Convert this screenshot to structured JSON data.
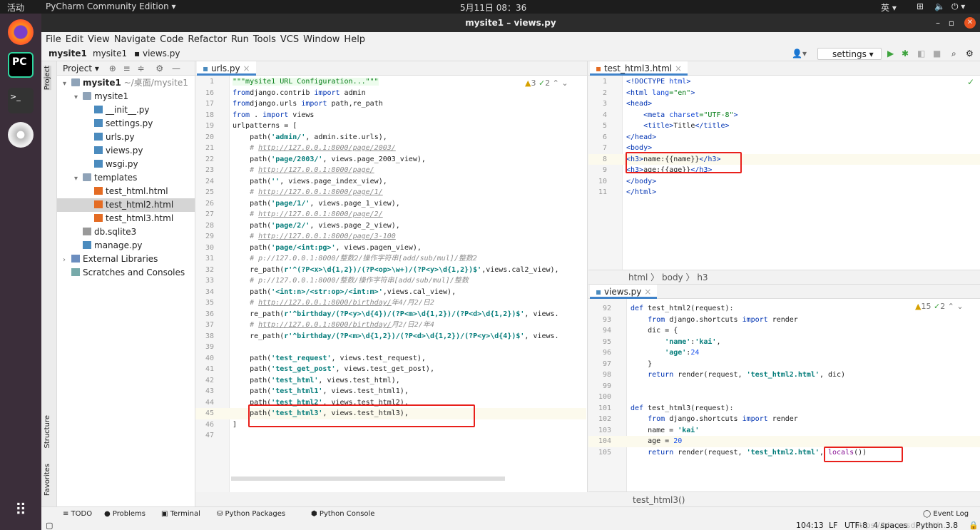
{
  "topbar": {
    "activities": "活动",
    "app": "PyCharm Community Edition ▾",
    "clock": "5月11日 08：36",
    "ime": "英 ▾"
  },
  "window": {
    "title": "mysite1 – views.py"
  },
  "menu": [
    "File",
    "Edit",
    "View",
    "Navigate",
    "Code",
    "Refactor",
    "Run",
    "Tools",
    "VCS",
    "Window",
    "Help"
  ],
  "breadcrumb": [
    "mysite1",
    "mysite1",
    "views.py"
  ],
  "run_config": "settings",
  "left_strip": [
    "Project",
    "Structure",
    "Favorites"
  ],
  "project": {
    "header": "Project ▾",
    "tree": [
      {
        "label": "mysite1",
        "extra": " ~/桌面/mysite1",
        "level": 0,
        "type": "folder",
        "arrow": "▾",
        "bold": true
      },
      {
        "label": "mysite1",
        "level": 1,
        "type": "folder",
        "arrow": "▾"
      },
      {
        "label": "__init__.py",
        "level": 2,
        "type": "py"
      },
      {
        "label": "settings.py",
        "level": 2,
        "type": "py"
      },
      {
        "label": "urls.py",
        "level": 2,
        "type": "py"
      },
      {
        "label": "views.py",
        "level": 2,
        "type": "py"
      },
      {
        "label": "wsgi.py",
        "level": 2,
        "type": "py"
      },
      {
        "label": "templates",
        "level": 1,
        "type": "folder",
        "arrow": "▾"
      },
      {
        "label": "test_html.html",
        "level": 2,
        "type": "html"
      },
      {
        "label": "test_html2.html",
        "level": 2,
        "type": "html",
        "selected": true
      },
      {
        "label": "test_html3.html",
        "level": 2,
        "type": "html"
      },
      {
        "label": "db.sqlite3",
        "level": 1,
        "type": "db"
      },
      {
        "label": "manage.py",
        "level": 1,
        "type": "py"
      },
      {
        "label": "External Libraries",
        "level": 0,
        "type": "lib",
        "arrow": "›"
      },
      {
        "label": "Scratches and Consoles",
        "level": 0,
        "type": "scratch"
      }
    ]
  },
  "urls": {
    "tab": "urls.py",
    "inspections": {
      "warnings": "3",
      "typos": "2"
    },
    "current_line": "45",
    "lines": [
      [
        "1",
        [
          [
            "d",
            "\"\"\"mysite1 URL Configuration...\"\"\""
          ]
        ]
      ],
      [
        "16",
        [
          [
            "k",
            "from"
          ],
          [
            "",
            "django.contrib "
          ],
          [
            "k",
            "import"
          ],
          [
            "",
            " admin"
          ]
        ]
      ],
      [
        "17",
        [
          [
            "k",
            "from"
          ],
          [
            "",
            "django.urls "
          ],
          [
            "k",
            "import"
          ],
          [
            "",
            " path,re_path"
          ]
        ]
      ],
      [
        "18",
        [
          [
            "k",
            "from"
          ],
          [
            "",
            " . "
          ],
          [
            "k",
            "import"
          ],
          [
            "",
            " views"
          ]
        ]
      ],
      [
        "19",
        [
          [
            "",
            "urlpatterns = ["
          ]
        ]
      ],
      [
        "20",
        [
          [
            "",
            "    path("
          ],
          [
            "s",
            "'admin/'"
          ],
          [
            "",
            ", admin.site.urls),"
          ]
        ]
      ],
      [
        "21",
        [
          [
            "c",
            "    # "
          ],
          [
            "u",
            "http://127.0.0.1:8000/page/2003/"
          ]
        ]
      ],
      [
        "22",
        [
          [
            "",
            "    path("
          ],
          [
            "s",
            "'page/2003/'"
          ],
          [
            "",
            ", views.page_2003_view),"
          ]
        ]
      ],
      [
        "23",
        [
          [
            "c",
            "    # "
          ],
          [
            "u",
            "http://127.0.0.1:8000/page/"
          ]
        ]
      ],
      [
        "24",
        [
          [
            "",
            "    path("
          ],
          [
            "s",
            "''"
          ],
          [
            "",
            ", views.page_index_view),"
          ]
        ]
      ],
      [
        "25",
        [
          [
            "c",
            "    # "
          ],
          [
            "u",
            "http://127.0.0.1:8000/page/1/"
          ]
        ]
      ],
      [
        "26",
        [
          [
            "",
            "    path("
          ],
          [
            "s",
            "'page/1/'"
          ],
          [
            "",
            ", views.page_1_view),"
          ]
        ]
      ],
      [
        "27",
        [
          [
            "c",
            "    # "
          ],
          [
            "u",
            "http://127.0.0.1:8000/page/2/"
          ]
        ]
      ],
      [
        "28",
        [
          [
            "",
            "    path("
          ],
          [
            "s",
            "'page/2/'"
          ],
          [
            "",
            ", views.page_2_view),"
          ]
        ]
      ],
      [
        "29",
        [
          [
            "c",
            "    # "
          ],
          [
            "u",
            "http://127.0.0.1:8000/page/3-100"
          ]
        ]
      ],
      [
        "30",
        [
          [
            "",
            "    path("
          ],
          [
            "s",
            "'page/<int:pg>'"
          ],
          [
            "",
            ", views.pagen_view),"
          ]
        ]
      ],
      [
        "31",
        [
          [
            "c",
            "    # p://127.0.0.1:8000/整数2/操作字符串[add/sub/mul]/整数2"
          ]
        ]
      ],
      [
        "32",
        [
          [
            "",
            "    re_path("
          ],
          [
            "s",
            "r'^(?P<x>\\d{1,2})/(?P<op>\\w+)/(?P<y>\\d{1,2})$'"
          ],
          [
            "",
            ",views.cal2_view),"
          ]
        ]
      ],
      [
        "33",
        [
          [
            "c",
            "    # p://127.0.0.1:8000/整数/操作字符串[add/sub/mul]/整数"
          ]
        ]
      ],
      [
        "34",
        [
          [
            "",
            "    path("
          ],
          [
            "s",
            "'<int:n>/<str:op>/<int:m>'"
          ],
          [
            "",
            ",views.cal_view),"
          ]
        ]
      ],
      [
        "35",
        [
          [
            "c",
            "    # "
          ],
          [
            "u",
            "http://127.0.0.1:8000/birthday/"
          ],
          [
            "c",
            "年4/月2/日2"
          ]
        ]
      ],
      [
        "36",
        [
          [
            "",
            "    re_path("
          ],
          [
            "s",
            "r'^birthday/(?P<y>\\d{4})/(?P<m>\\d{1,2})/(?P<d>\\d{1,2})$'"
          ],
          [
            "",
            ", views."
          ]
        ]
      ],
      [
        "37",
        [
          [
            "c",
            "    # "
          ],
          [
            "u",
            "http://127.0.0.1:8000/birthday/"
          ],
          [
            "c",
            "月2/日2/年4"
          ]
        ]
      ],
      [
        "38",
        [
          [
            "",
            "    re_path("
          ],
          [
            "s",
            "r'^birthday/(?P<m>\\d{1,2})/(?P<d>\\d{1,2})/(?P<y>\\d{4})$'"
          ],
          [
            "",
            ", views."
          ]
        ]
      ],
      [
        "39",
        []
      ],
      [
        "40",
        [
          [
            "",
            "    path("
          ],
          [
            "s",
            "'test_request'"
          ],
          [
            "",
            ", views.test_request),"
          ]
        ]
      ],
      [
        "41",
        [
          [
            "",
            "    path("
          ],
          [
            "s",
            "'test_get_post'"
          ],
          [
            "",
            ", views.test_get_post),"
          ]
        ]
      ],
      [
        "42",
        [
          [
            "",
            "    path("
          ],
          [
            "s",
            "'test_html'"
          ],
          [
            "",
            ", views.test_html),"
          ]
        ]
      ],
      [
        "43",
        [
          [
            "",
            "    path("
          ],
          [
            "s",
            "'test_html1'"
          ],
          [
            "",
            ", views.test_html1),"
          ]
        ]
      ],
      [
        "44",
        [
          [
            "",
            "    path("
          ],
          [
            "s",
            "'test_html2'"
          ],
          [
            "",
            ", views.test_html2),"
          ]
        ]
      ],
      [
        "45",
        [
          [
            "",
            "    path("
          ],
          [
            "s",
            "'test_html3'"
          ],
          [
            "",
            ", views.test_html3),"
          ]
        ]
      ],
      [
        "46",
        [
          [
            "",
            "]"
          ]
        ]
      ],
      [
        "47",
        []
      ]
    ]
  },
  "html": {
    "tab": "test_html3.html",
    "current_line": "8",
    "breadcrumb": [
      "html",
      "body",
      "h3"
    ],
    "lines": [
      [
        "1",
        [
          [
            "t",
            "<!DOCTYPE "
          ],
          [
            "a",
            "html"
          ],
          [
            "t",
            ">"
          ]
        ]
      ],
      [
        "2",
        [
          [
            "t",
            "<html "
          ],
          [
            "a",
            "lang"
          ],
          [
            "av",
            "=\"en\""
          ],
          [
            "t",
            ">"
          ]
        ]
      ],
      [
        "3",
        [
          [
            "t",
            "<head>"
          ]
        ]
      ],
      [
        "4",
        [
          [
            "",
            "    "
          ],
          [
            "t",
            "<meta "
          ],
          [
            "a",
            "charset"
          ],
          [
            "av",
            "=\"UTF-8\""
          ],
          [
            "t",
            ">"
          ]
        ]
      ],
      [
        "5",
        [
          [
            "",
            "    "
          ],
          [
            "t",
            "<title>"
          ],
          [
            "",
            "Title"
          ],
          [
            "t",
            "</title>"
          ]
        ]
      ],
      [
        "6",
        [
          [
            "t",
            "</head>"
          ]
        ]
      ],
      [
        "7",
        [
          [
            "t",
            "<body>"
          ]
        ]
      ],
      [
        "8",
        [
          [
            "t",
            "<h3>"
          ],
          [
            "",
            "name:{{name}}"
          ],
          [
            "t",
            "</h3>"
          ]
        ]
      ],
      [
        "9",
        [
          [
            "t",
            "<h3>"
          ],
          [
            "",
            "age:{{age}}"
          ],
          [
            "t",
            "</h3>"
          ]
        ]
      ],
      [
        "10",
        [
          [
            "t",
            "</body>"
          ]
        ]
      ],
      [
        "11",
        [
          [
            "t",
            "</html>"
          ]
        ]
      ]
    ]
  },
  "views": {
    "tab": "views.py",
    "inspections": {
      "warnings": "15",
      "typos": "2"
    },
    "current_line": "104",
    "function_breadcrumb": "test_html3()",
    "lines": [
      [
        "92",
        [
          [
            "k",
            "def"
          ],
          [
            "",
            " test_html2(request):"
          ]
        ]
      ],
      [
        "93",
        [
          [
            "",
            "    "
          ],
          [
            "k",
            "from"
          ],
          [
            "",
            " django.shortcuts "
          ],
          [
            "k",
            "import"
          ],
          [
            "",
            " render"
          ]
        ]
      ],
      [
        "94",
        [
          [
            "",
            "    dic = {"
          ]
        ]
      ],
      [
        "95",
        [
          [
            "",
            "        "
          ],
          [
            "s",
            "'name'"
          ],
          [
            "",
            ":"
          ],
          [
            "s",
            "'kai'"
          ],
          [
            "",
            ","
          ]
        ]
      ],
      [
        "96",
        [
          [
            "",
            "        "
          ],
          [
            "s",
            "'age'"
          ],
          [
            "",
            ":"
          ],
          [
            "n",
            "24"
          ]
        ]
      ],
      [
        "97",
        [
          [
            "",
            "    }"
          ]
        ]
      ],
      [
        "98",
        [
          [
            "",
            "    "
          ],
          [
            "k",
            "return"
          ],
          [
            "",
            " render(request, "
          ],
          [
            "s",
            "'test_html2.html'"
          ],
          [
            "",
            ", dic)"
          ]
        ]
      ],
      [
        "99",
        []
      ],
      [
        "100",
        []
      ],
      [
        "101",
        [
          [
            "k",
            "def"
          ],
          [
            "",
            " test_html3(request):"
          ]
        ]
      ],
      [
        "102",
        [
          [
            "",
            "    "
          ],
          [
            "k",
            "from"
          ],
          [
            "",
            " django.shortcuts "
          ],
          [
            "k",
            "import"
          ],
          [
            "",
            " render"
          ]
        ]
      ],
      [
        "103",
        [
          [
            "",
            "    name = "
          ],
          [
            "s",
            "'kai'"
          ]
        ]
      ],
      [
        "104",
        [
          [
            "",
            "    age = "
          ],
          [
            "n",
            "20"
          ]
        ]
      ],
      [
        "105",
        [
          [
            "",
            "    "
          ],
          [
            "k",
            "return"
          ],
          [
            "",
            " render(request, "
          ],
          [
            "s",
            "'test_html2.html'"
          ],
          [
            "",
            ", "
          ],
          [
            "f",
            "locals"
          ],
          [
            "",
            "())"
          ]
        ]
      ]
    ]
  },
  "toolwindows": [
    "≡ TODO",
    "● Problems",
    "▣ Terminal",
    "⛁ Python Packages",
    "⬢ Python Console"
  ],
  "event_log": "◯ Event Log",
  "status": {
    "position": "104:13",
    "line_sep": "LF",
    "encoding": "UTF-8",
    "indent": "4 spaces",
    "interpreter": "Python 3.8"
  },
  "watermark": "https://blog.csdn.net/...",
  "colors": {
    "highlight_box": "#e8201b",
    "tab_accent": "#4083c9",
    "run_green": "#3da33d"
  }
}
